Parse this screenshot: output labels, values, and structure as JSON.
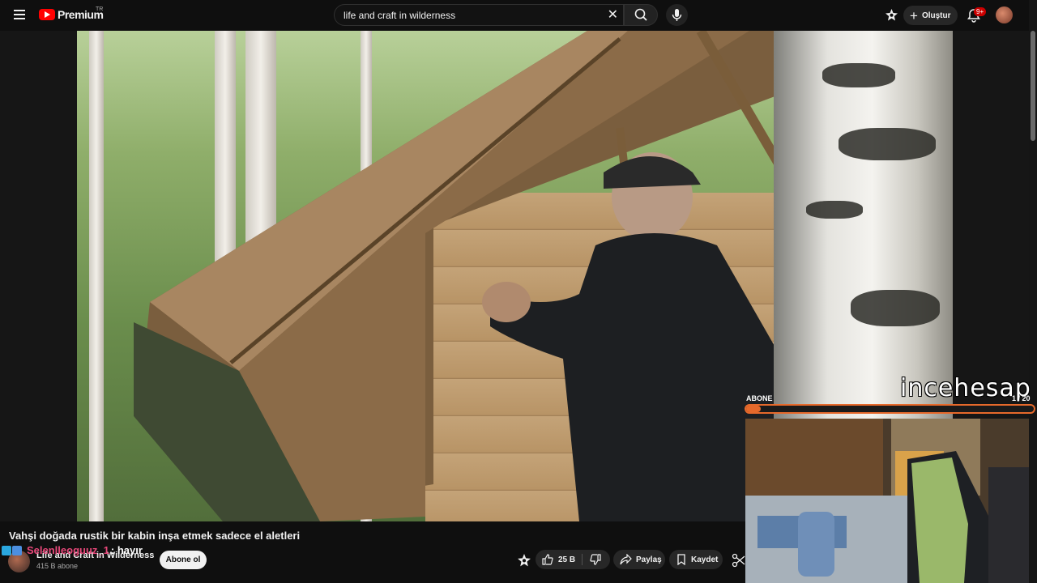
{
  "header": {
    "brand": "Premium",
    "country_code": "TR",
    "search_value": "life and craft in wilderness",
    "create_label": "Oluştur",
    "notifications_badge": "9+"
  },
  "video": {
    "title": "Vahşi doğada rustik bir kabin inşa etmek sadece el aletleri",
    "channel_name": "Life and Craft in Wilderness",
    "subscribers": "415 B abone",
    "subscribe_label": "Abone ol",
    "likes": "25 B",
    "share_label": "Paylaş",
    "save_label": "Kaydet"
  },
  "chat_overlay": {
    "user": "Selenlleoguuz_1",
    "message": ": hayır"
  },
  "stream_overlay": {
    "goal_label": "ABONE",
    "goal_count": "1 / 20",
    "goal_progress": 0.05,
    "watermark": "incehesap"
  },
  "colors": {
    "accent_red": "#ff0000",
    "goal_orange": "#e6692b",
    "chat_user": "#e8487a"
  },
  "icons": [
    "menu-icon",
    "search-icon",
    "clear-icon",
    "mic-icon",
    "premium-star-icon",
    "plus-icon",
    "bell-icon",
    "like-icon",
    "dislike-icon",
    "share-icon",
    "save-icon",
    "clip-icon"
  ]
}
